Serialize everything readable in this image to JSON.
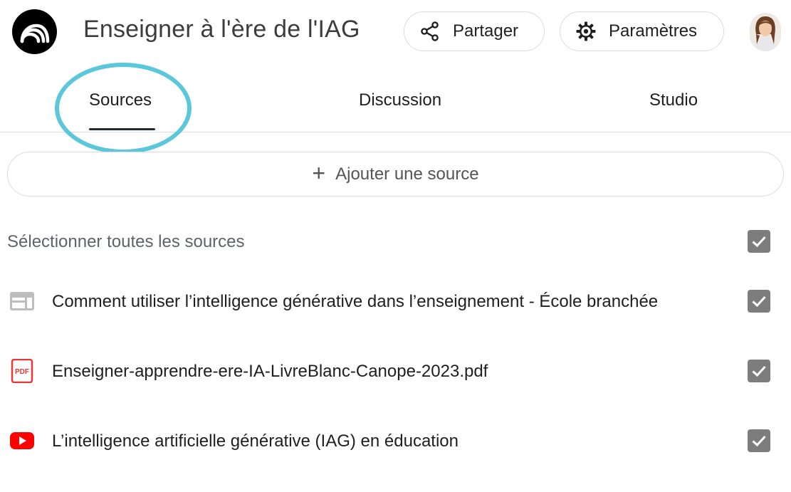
{
  "header": {
    "title": "Enseigner à l'ère de l'IAG",
    "share_label": "Partager",
    "settings_label": "Paramètres"
  },
  "tabs": [
    {
      "label": "Sources",
      "active": true
    },
    {
      "label": "Discussion",
      "active": false
    },
    {
      "label": "Studio",
      "active": false
    }
  ],
  "add_source": {
    "plus": "+",
    "label": "Ajouter une source"
  },
  "select_all": {
    "label": "Sélectionner toutes les sources",
    "checked": true
  },
  "sources": [
    {
      "icon": "web-page-icon",
      "title": "Comment utiliser l’intelligence générative dans l’enseignement - École branchée",
      "checked": true
    },
    {
      "icon": "pdf-icon",
      "title": "Enseigner-apprendre-ere-IA-LivreBlanc-Canope-2023.pdf",
      "checked": true
    },
    {
      "icon": "youtube-icon",
      "title": "L’intelligence artificielle générative (IAG) en éducation",
      "checked": true
    }
  ],
  "colors": {
    "highlight": "#5bc7da",
    "checkbox": "#7d7d7d",
    "pdf": "#e53935",
    "youtube": "#ff0000"
  }
}
